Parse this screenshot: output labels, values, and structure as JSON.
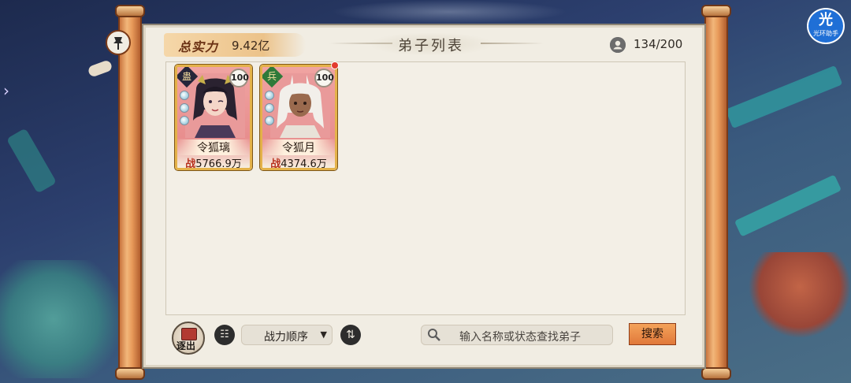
{
  "header": {
    "total_power_label": "总实力",
    "total_power_value": "9.42亿",
    "title": "弟子列表",
    "disciple_count": "134/200"
  },
  "disciples": [
    {
      "type_badge": "蛊",
      "level": "100",
      "name": "令狐璃",
      "power_prefix": "战",
      "power": "5766.9万",
      "has_notification": false
    },
    {
      "type_badge": "兵",
      "level": "100",
      "name": "令狐月",
      "power_prefix": "战",
      "power": "4374.6万",
      "has_notification": true
    }
  ],
  "toolbar": {
    "exit_label": "逐出",
    "sort_label": "战力顺序",
    "search_placeholder": "输入名称或状态查找弟子",
    "search_button": "搜索"
  },
  "overlay": {
    "helper_glyph": "光",
    "helper_label": "光环助手"
  },
  "colors": {
    "paper": "#f1ede3",
    "accent_orange": "#e0783a",
    "card_border_gold": "#e4b24a",
    "card_pink": "#f0a4a2",
    "power_text_red": "#b8321e"
  }
}
